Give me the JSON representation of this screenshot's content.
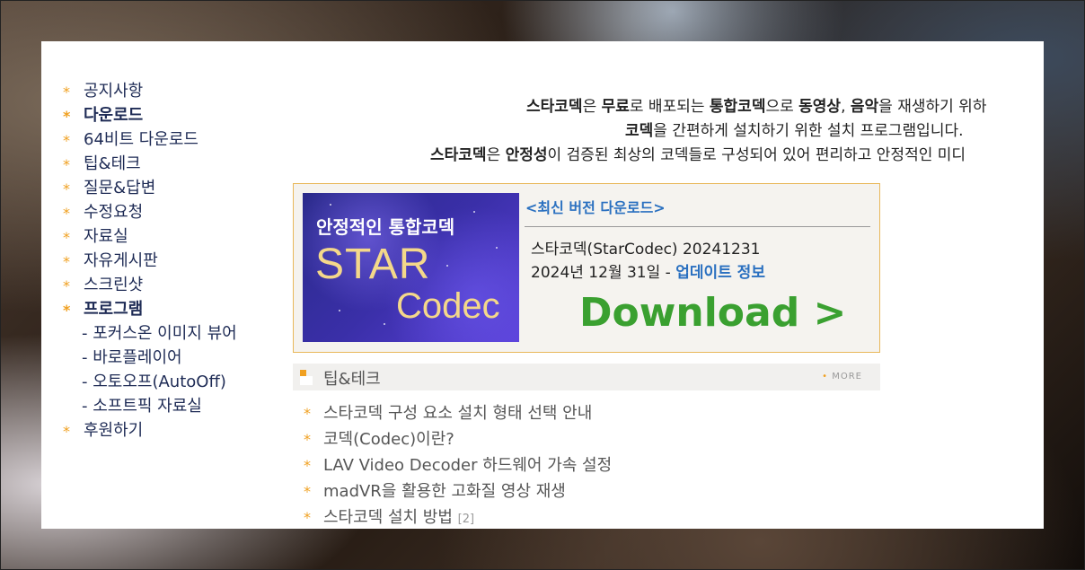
{
  "sidebar": {
    "items": [
      {
        "label": "공지사항",
        "bold": false
      },
      {
        "label": "다운로드",
        "bold": true
      },
      {
        "label": "64비트 다운로드",
        "bold": false
      },
      {
        "label": "팁&테크",
        "bold": false
      },
      {
        "label": "질문&답변",
        "bold": false
      },
      {
        "label": "수정요청",
        "bold": false
      },
      {
        "label": "자료실",
        "bold": false
      },
      {
        "label": "자유게시판",
        "bold": false
      },
      {
        "label": "스크린샷",
        "bold": false
      },
      {
        "label": "프로그램",
        "bold": true
      }
    ],
    "sub_items": [
      "- 포커스온 이미지 뷰어",
      "- 바로플레이어",
      "- 오토오프(AutoOff)",
      "- 소프트픽 자료실"
    ],
    "last_item": "후원하기"
  },
  "intro": {
    "l1_a": "스타코덱",
    "l1_b": "은 ",
    "l1_c": "무료",
    "l1_d": "로 배포되는 ",
    "l1_e": "통합코덱",
    "l1_f": "으로 ",
    "l1_g": "동영상",
    "l1_h": ", ",
    "l1_i": "음악",
    "l1_j": "을 재생하기 위하",
    "l2_a": "코덱",
    "l2_b": "을 간편하게 설치하기 위한 설치 프로그램입니다.",
    "l3_a": "스타코덱",
    "l3_b": "은 ",
    "l3_c": "안정성",
    "l3_d": "이 검증된 최상의 코덱들로 구성되어 있어 편리하고 안정적인 미디"
  },
  "banner": {
    "subtitle": "안정적인 통합코덱",
    "title_star": "STAR",
    "title_codec": "Codec"
  },
  "download": {
    "latest_link": "<최신 버전 다운로드>",
    "version": "스타코덱(StarCodec) 20241231",
    "date": "2024년 12월 31일 - ",
    "update_link": "업데이트 정보",
    "button": "Download >"
  },
  "tips": {
    "title": "팁&테크",
    "more": "MORE",
    "items": [
      {
        "label": "스타코덱 구성 요소 설치 형태 선택 안내",
        "count": ""
      },
      {
        "label": "코덱(Codec)이란?",
        "count": ""
      },
      {
        "label": "LAV Video Decoder 하드웨어 가속 설정",
        "count": ""
      },
      {
        "label": "madVR을 활용한 고화질 영상 재생",
        "count": ""
      },
      {
        "label": "스타코덱 설치 방법",
        "count": "[2]"
      }
    ]
  },
  "colors": {
    "bullet": "#f0a020",
    "link": "#2a70c0",
    "download_green": "#3aa030",
    "box_border": "#e8b85a"
  }
}
